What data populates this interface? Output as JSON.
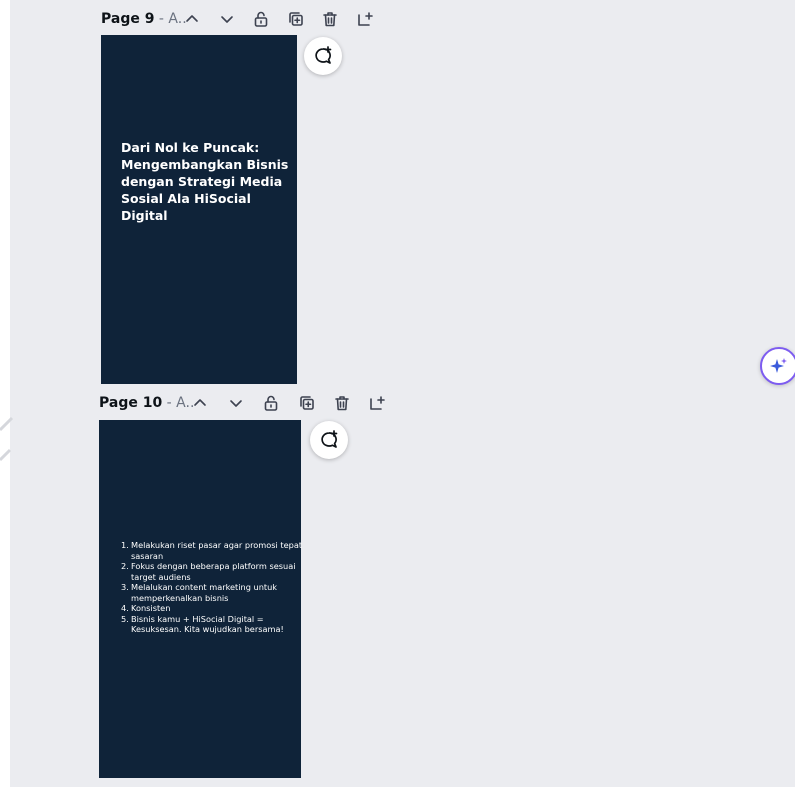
{
  "pages": [
    {
      "title_bold": "Page 9",
      "title_rest": " - A..",
      "heading": "Dari Nol ke Puncak:\nMengembangkan Bisnis\ndengan Strategi Media\nSosial Ala HiSocial Digital"
    },
    {
      "title_bold": "Page 10",
      "title_rest": " - A..",
      "list": [
        {
          "num": "1.",
          "text": "Melakukan riset pasar agar promosi tepat sasaran"
        },
        {
          "num": "2.",
          "text": "Fokus dengan beberapa platform sesuai target audiens"
        },
        {
          "num": "3.",
          "text": "Melalukan content marketing untuk memperkenalkan bisnis"
        },
        {
          "num": "4.",
          "text": "Konsisten"
        },
        {
          "num": "5.",
          "text": "Bisnis kamu + HiSocial Digital = Kesuksesan. Kita wujudkan bersama!"
        }
      ]
    }
  ],
  "icons": {
    "move_up": "chevron-up-icon",
    "move_down": "chevron-down-icon",
    "lock": "unlock-icon",
    "duplicate": "duplicate-icon",
    "delete": "trash-icon",
    "add_page": "add-page-icon",
    "comment": "add-comment-icon",
    "magic": "sparkle-icon"
  },
  "colors": {
    "canvas_bg": "#ebecf0",
    "page_bg": "#0f2339",
    "accent": "#7d5cf0"
  }
}
